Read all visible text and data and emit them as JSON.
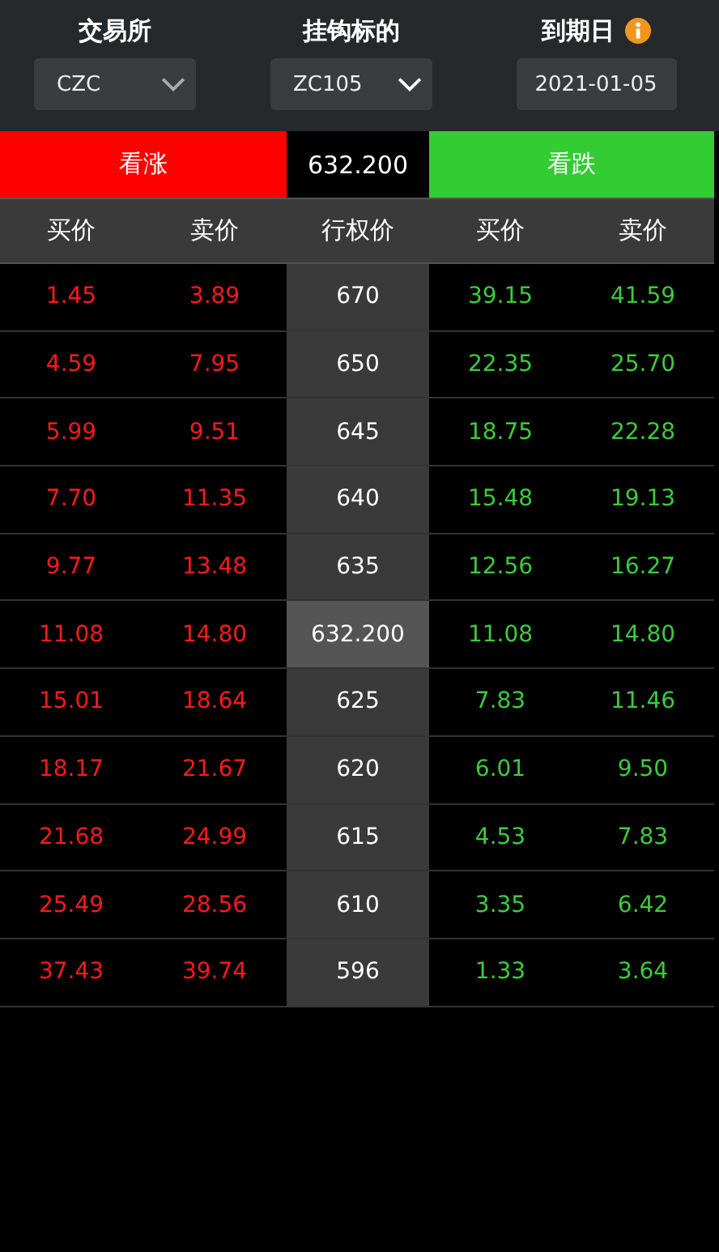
{
  "filters": [
    {
      "label": "交易所",
      "value": "CZC",
      "kind": "dropdown",
      "info": false
    },
    {
      "label": "挂钩标的",
      "value": "ZC105",
      "kind": "dropdown",
      "info": false
    },
    {
      "label": "到期日",
      "value": "2021-01-05",
      "kind": "date",
      "info": true
    }
  ],
  "banner": {
    "call": "看涨",
    "price": "632.200",
    "put": "看跌"
  },
  "columns": [
    "买价",
    "卖价",
    "行权价",
    "买价",
    "卖价"
  ],
  "rows": [
    {
      "call_bid": "1.45",
      "call_ask": "3.89",
      "strike": "670",
      "put_bid": "39.15",
      "put_ask": "41.59",
      "highlighted": false
    },
    {
      "call_bid": "4.59",
      "call_ask": "7.95",
      "strike": "650",
      "put_bid": "22.35",
      "put_ask": "25.70",
      "highlighted": false
    },
    {
      "call_bid": "5.99",
      "call_ask": "9.51",
      "strike": "645",
      "put_bid": "18.75",
      "put_ask": "22.28",
      "highlighted": false
    },
    {
      "call_bid": "7.70",
      "call_ask": "11.35",
      "strike": "640",
      "put_bid": "15.48",
      "put_ask": "19.13",
      "highlighted": false
    },
    {
      "call_bid": "9.77",
      "call_ask": "13.48",
      "strike": "635",
      "put_bid": "12.56",
      "put_ask": "16.27",
      "highlighted": false
    },
    {
      "call_bid": "11.08",
      "call_ask": "14.80",
      "strike": "632.200",
      "put_bid": "11.08",
      "put_ask": "14.80",
      "highlighted": true
    },
    {
      "call_bid": "15.01",
      "call_ask": "18.64",
      "strike": "625",
      "put_bid": "7.83",
      "put_ask": "11.46",
      "highlighted": false
    },
    {
      "call_bid": "18.17",
      "call_ask": "21.67",
      "strike": "620",
      "put_bid": "6.01",
      "put_ask": "9.50",
      "highlighted": false
    },
    {
      "call_bid": "21.68",
      "call_ask": "24.99",
      "strike": "615",
      "put_bid": "4.53",
      "put_ask": "7.83",
      "highlighted": false
    },
    {
      "call_bid": "25.49",
      "call_ask": "28.56",
      "strike": "610",
      "put_bid": "3.35",
      "put_ask": "6.42",
      "highlighted": false
    },
    {
      "call_bid": "37.43",
      "call_ask": "39.74",
      "strike": "596",
      "put_bid": "1.33",
      "put_ask": "3.64",
      "highlighted": false
    }
  ]
}
